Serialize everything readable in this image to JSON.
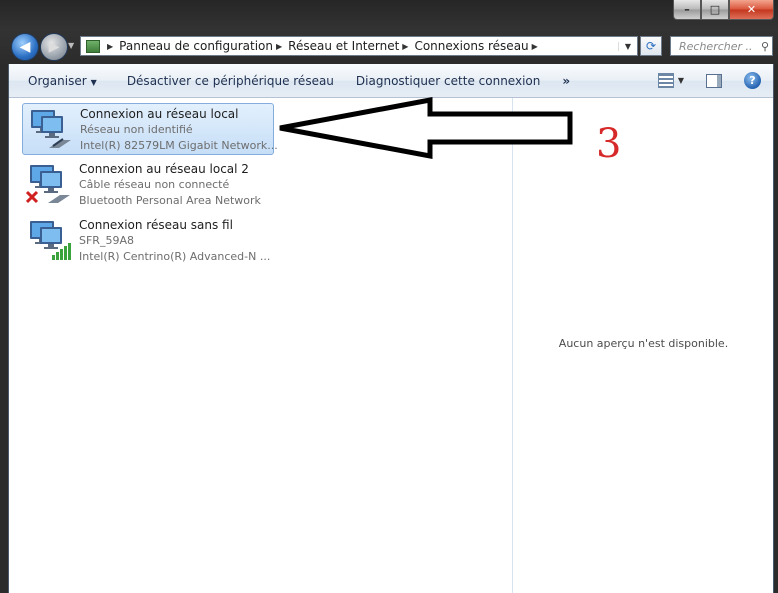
{
  "window": {
    "caption": {
      "minimize": "–",
      "maximize": "□",
      "close": "✕"
    }
  },
  "nav": {
    "back_glyph": "◀",
    "forward_glyph": "▶"
  },
  "address": {
    "crumbs": [
      "Panneau de configuration",
      "Réseau et Internet",
      "Connexions réseau"
    ]
  },
  "search": {
    "placeholder": "Rechercher ..."
  },
  "toolbar": {
    "organize": "Organiser",
    "disable": "Désactiver ce périphérique réseau",
    "diagnose": "Diagnostiquer cette connexion",
    "more": "»"
  },
  "connections": [
    {
      "name": "Connexion au réseau local",
      "status": "Réseau non identifié",
      "device": "Intel(R) 82579LM Gigabit Network...",
      "icon": "ethernet-connected-icon",
      "selected": true
    },
    {
      "name": "Connexion au réseau local 2",
      "status": "Câble réseau non connecté",
      "device": "Bluetooth Personal Area Network",
      "icon": "ethernet-disconnected-icon",
      "selected": false
    },
    {
      "name": "Connexion réseau sans fil",
      "status": "SFR_59A8",
      "device": "Intel(R) Centrino(R) Advanced-N ...",
      "icon": "wireless-signal-icon",
      "selected": false
    }
  ],
  "preview": {
    "message": "Aucun aperçu n'est disponible."
  },
  "annotation": {
    "number": "3"
  },
  "colors": {
    "selection": "#c6def7",
    "annotation_red": "#d62a2a"
  }
}
